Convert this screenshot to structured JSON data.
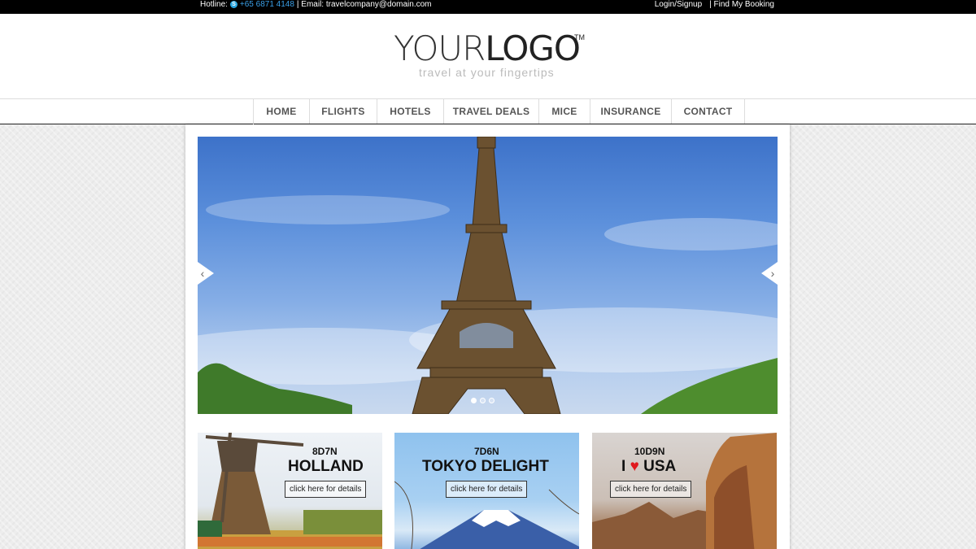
{
  "topbar": {
    "hotline_label": "Hotline:",
    "skype_icon": "skype-icon",
    "phone": "+65 6871 4148",
    "email_text": "| Email: travelcompany@domain.com",
    "login": "Login/Signup",
    "booking": "| Find My Booking"
  },
  "logo": {
    "word_thin": "YOUR",
    "word_bold": "LOGO",
    "tm": "TM",
    "tagline": "travel at your fingertips"
  },
  "nav": {
    "items": [
      "HOME",
      "FLIGHTS",
      "HOTELS",
      "TRAVEL DEALS",
      "MICE",
      "INSURANCE",
      "CONTACT"
    ]
  },
  "slider": {
    "prev_icon": "chevron-left-icon",
    "next_icon": "chevron-right-icon",
    "prev_glyph": "‹",
    "next_glyph": "›",
    "slide_count": 3,
    "active_slide": 1
  },
  "deals": [
    {
      "nights": "8D7N",
      "name": "HOLLAND",
      "cta": "click here for details"
    },
    {
      "nights": "7D6N",
      "name": "TOKYO DELIGHT",
      "cta": "click here for details"
    },
    {
      "nights": "10D9N",
      "name_prefix": "I",
      "name_suffix": "USA",
      "cta": "click here for details"
    }
  ],
  "colors": {
    "topbar_bg": "#000000",
    "phone_link": "#3aa0e8",
    "heart": "#e0191e"
  }
}
